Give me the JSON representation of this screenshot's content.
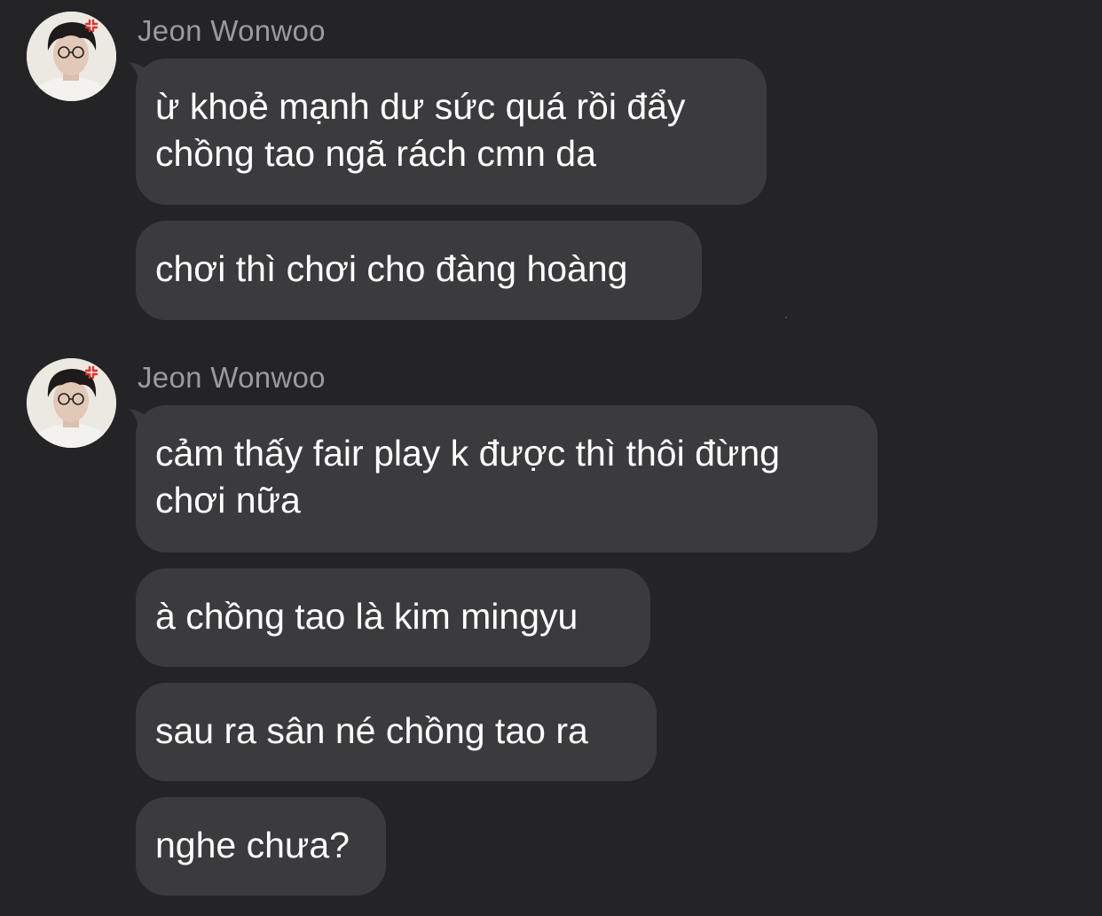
{
  "groups": [
    {
      "sender": "Jeon Wonwoo",
      "avatar_icon": "profile-photo-avatar",
      "messages": [
        {
          "lines": [
            "ừ khoẻ mạnh dư sức quá rồi đẩy",
            "chồng tao ngã rách cmn da"
          ]
        },
        {
          "lines": [
            "chơi thì chơi cho đàng hoàng"
          ]
        }
      ]
    },
    {
      "sender": "Jeon Wonwoo",
      "avatar_icon": "profile-photo-avatar",
      "messages": [
        {
          "lines": [
            "cảm thấy fair play k được thì thôi đừng",
            "chơi nữa"
          ]
        },
        {
          "lines": [
            "à chồng tao là kim mingyu"
          ]
        },
        {
          "lines": [
            "sau ra sân né chồng tao ra"
          ]
        },
        {
          "lines": [
            "nghe chưa?"
          ]
        }
      ]
    }
  ],
  "colors": {
    "background": "#242426",
    "bubble": "#3b3b3d",
    "text": "#ffffff",
    "sender": "#9a9a9f"
  }
}
